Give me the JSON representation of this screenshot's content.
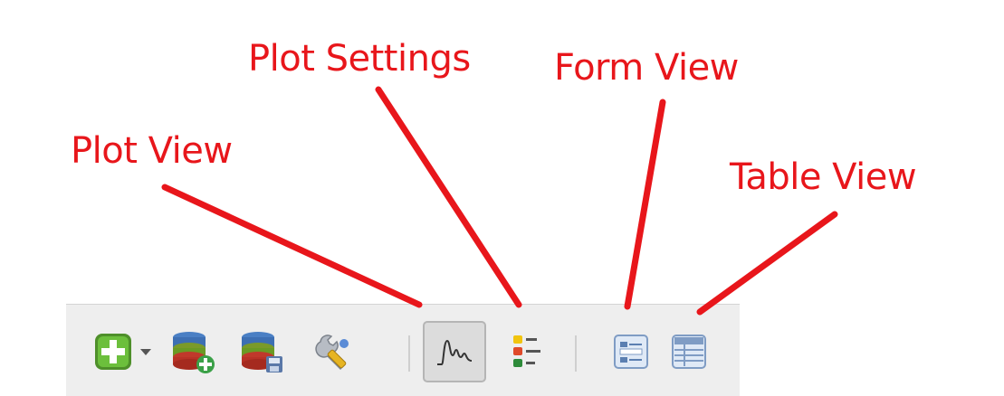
{
  "callouts": {
    "plot_view": "Plot View",
    "plot_settings": "Plot Settings",
    "form_view": "Form View",
    "table_view": "Table View"
  },
  "colors": {
    "callout": "#e8161b",
    "toolbar_bg": "#eeeeee",
    "active_button_bg": "#dcdcdc"
  },
  "toolbar": {
    "buttons": [
      {
        "name": "add-feature",
        "icon": "green-plus-icon"
      },
      {
        "name": "add-dropdown",
        "icon": "caret-down-icon"
      },
      {
        "name": "add-layer",
        "icon": "database-add-icon"
      },
      {
        "name": "save-layer",
        "icon": "database-save-icon"
      },
      {
        "name": "tools",
        "icon": "wrench-tools-icon"
      },
      {
        "name": "plot-view",
        "icon": "plot-line-icon",
        "active": true
      },
      {
        "name": "plot-settings",
        "icon": "plot-settings-icon"
      },
      {
        "name": "form-view",
        "icon": "form-view-icon"
      },
      {
        "name": "table-view",
        "icon": "table-view-icon"
      }
    ]
  }
}
